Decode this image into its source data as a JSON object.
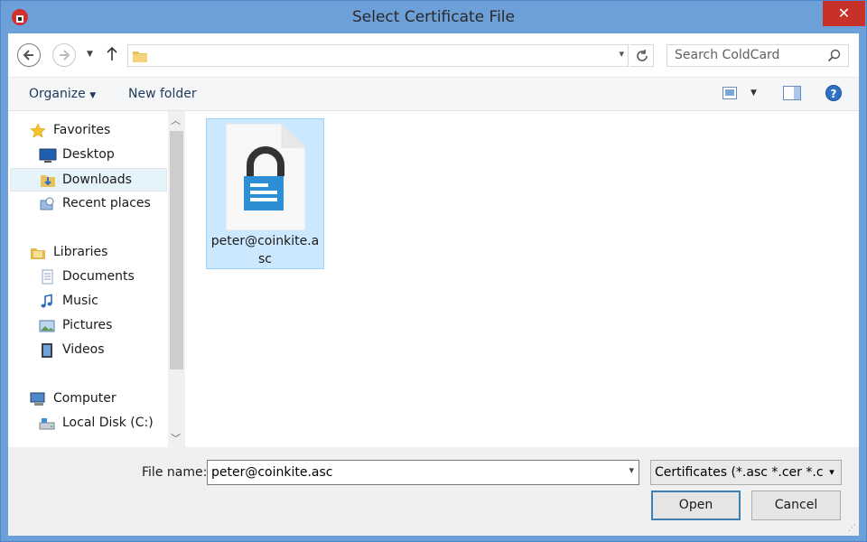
{
  "window": {
    "title": "Select Certificate File",
    "close_glyph": "✕"
  },
  "address": {
    "path": "",
    "search_placeholder": "Search ColdCard"
  },
  "toolbar": {
    "organize_label": "Organize",
    "new_folder_label": "New folder",
    "help_glyph": "?"
  },
  "nav": {
    "favorites": "Favorites",
    "desktop": "Desktop",
    "downloads": "Downloads",
    "recent_places": "Recent places",
    "libraries": "Libraries",
    "documents": "Documents",
    "music": "Music",
    "pictures": "Pictures",
    "videos": "Videos",
    "computer": "Computer",
    "local_disk": "Local Disk (C:)"
  },
  "files": [
    {
      "name": "peter@coinkite.asc",
      "icon": "certificate-file-icon",
      "selected": true
    }
  ],
  "bottom": {
    "file_name_label": "File name:",
    "file_name_value": "peter@coinkite.asc",
    "filter_value": "Certificates (*.asc *.cer *.cert",
    "open_label": "Open",
    "cancel_label": "Cancel"
  },
  "colors": {
    "title_bar": "#6d9fd8",
    "close_button": "#c7312a",
    "selection": "#cce8ff",
    "lock_blue": "#2a8fd4"
  }
}
